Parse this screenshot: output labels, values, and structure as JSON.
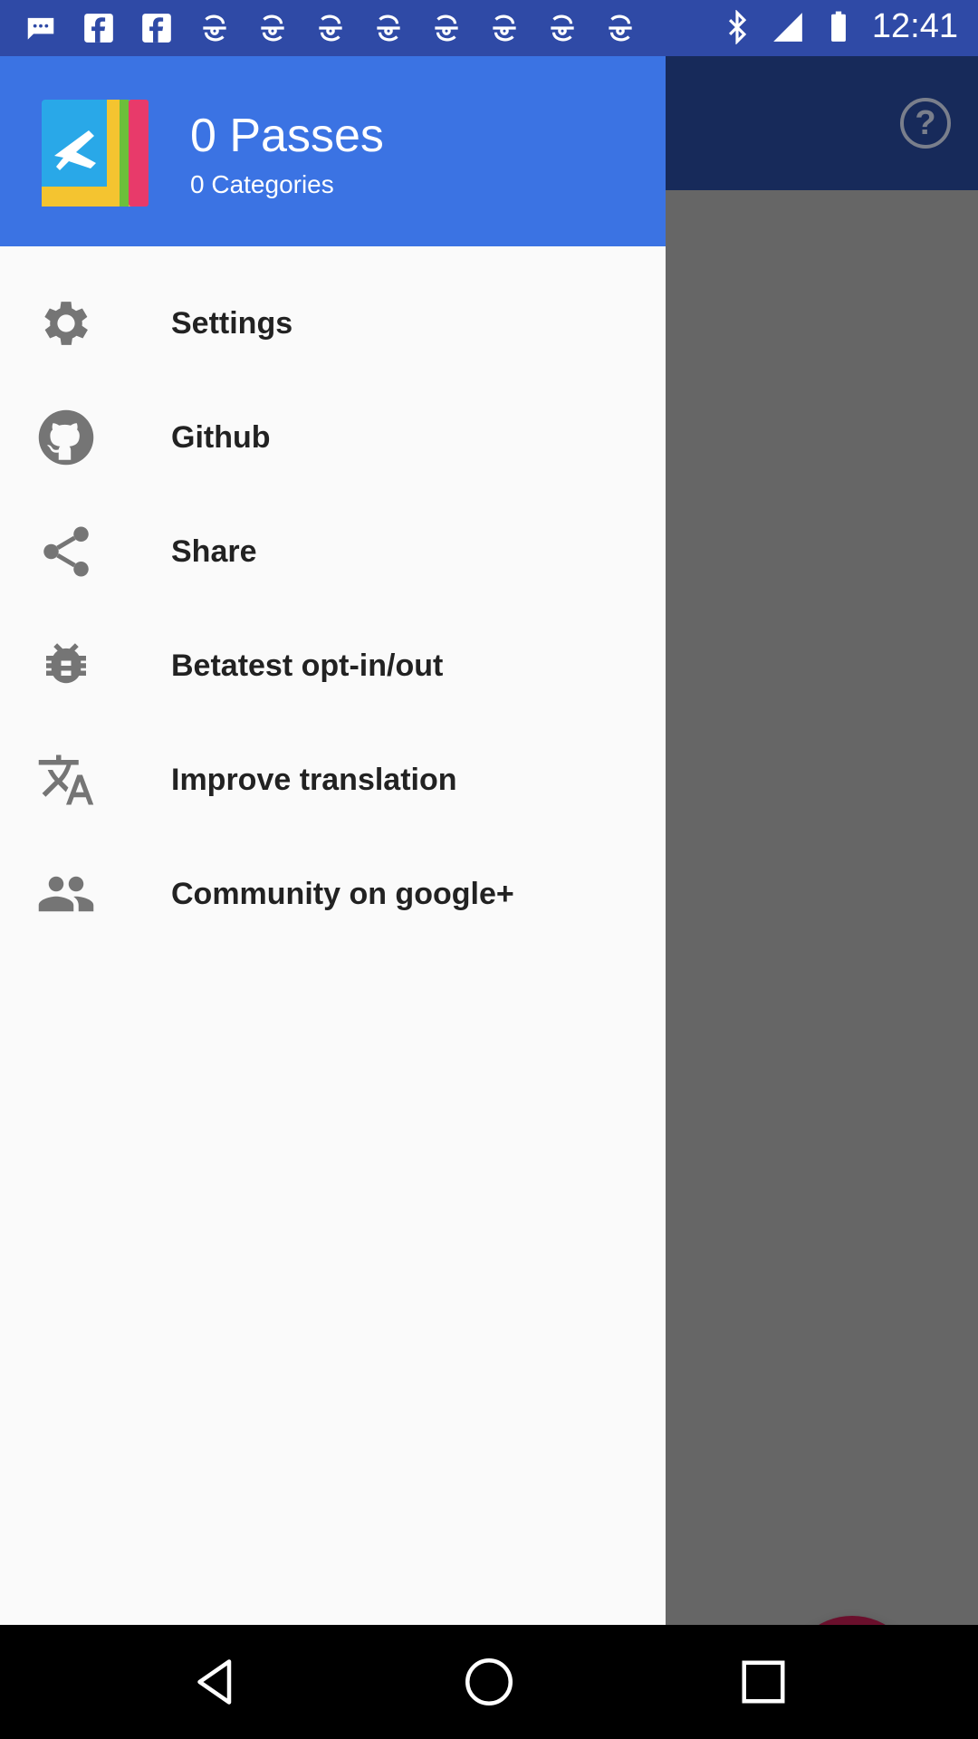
{
  "status_bar": {
    "time": "12:41",
    "icons": [
      "message-icon",
      "facebook-icon",
      "facebook-icon",
      "fan-icon",
      "fan-icon",
      "fan-icon",
      "fan-icon",
      "fan-icon",
      "fan-icon",
      "fan-icon",
      "fan-icon",
      "bluetooth-icon",
      "signal-icon",
      "battery-icon"
    ]
  },
  "drawer": {
    "header": {
      "title": "0 Passes",
      "subtitle": "0 Categories"
    },
    "items": [
      {
        "label": "Settings",
        "icon": "gear-icon"
      },
      {
        "label": "Github",
        "icon": "github-icon"
      },
      {
        "label": "Share",
        "icon": "share-icon"
      },
      {
        "label": "Betatest opt-in/out",
        "icon": "bug-icon"
      },
      {
        "label": "Improve translation",
        "icon": "translate-icon"
      },
      {
        "label": "Community on google+",
        "icon": "people-icon"
      }
    ]
  },
  "toolbar": {
    "help_label": "?"
  },
  "colors": {
    "status_bar": "#2f4aa6",
    "drawer_header": "#3b73e3",
    "fab": "#6a0f2c",
    "scrim": "#666666"
  }
}
